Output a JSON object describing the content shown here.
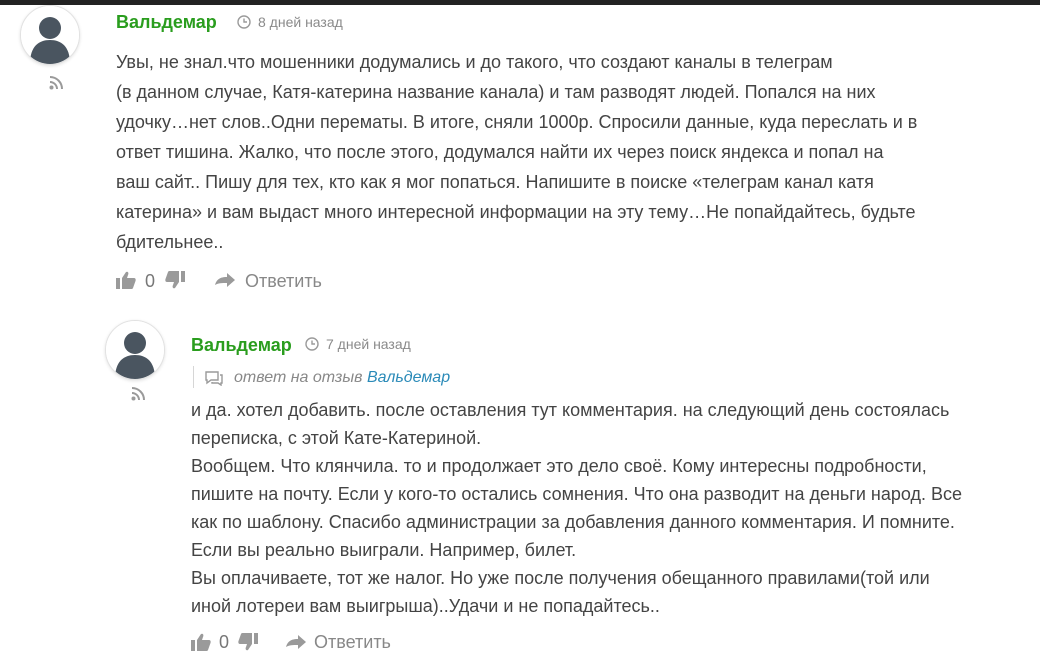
{
  "comments": [
    {
      "author": "Вальдемар",
      "date": "8 дней назад",
      "lines": [
        "Увы, не знал.что мошенники додумались и до такого, что создают каналы в телеграм",
        "(в данном случае, Катя-катерина название канала) и там разводят людей. Попался на них",
        "удочку…нет слов..Одни перематы. В итоге, сняли 1000р. Спросили данные, куда переслать и в",
        "ответ тишина. Жалко, что после этого, додумался найти их через поиск яндекса и попал на",
        "ваш сайт.. Пишу для тех, кто как я мог попаться. Напишите в поиске «телеграм канал катя",
        "катерина» и вам выдаст много интересной информации на эту тему…Не попайдайтесь, будьте",
        "бдительнее.."
      ],
      "votes": "0",
      "reply_label": "Ответить",
      "icons": {
        "avatar": "user-avatar-icon",
        "rss": "rss-icon",
        "clock": "clock-icon",
        "like": "thumbs-up-icon",
        "dislike": "thumbs-down-icon",
        "reply": "reply-arrow-icon"
      }
    },
    {
      "author": "Вальдемар",
      "date": "7 дней назад",
      "reply_to_text": "ответ на отзыв",
      "reply_to_name": "Вальдемар",
      "lines": [
        "и да. хотел добавить. после оставления тут комментария. на следующий день состоялась",
        "переписка, с этой Кате-Катериной.",
        "Вообщем. Что клянчила. то и продолжает это дело своё. Кому интересны подробности,",
        "пишите на почту. Если у кого-то остались сомнения. Что она разводит на деньги народ. Все",
        "как по шаблону. Спасибо администрации за добавления данного комментария. И помните.",
        "Если вы реально выиграли. Например, билет.",
        "Вы оплачиваете, тот же налог. Но уже после получения обещанного правилами(той или",
        "иной лотереи вам выигрыша)..Удачи и не попадайтесь.."
      ],
      "votes": "0",
      "reply_label": "Ответить",
      "icons": {
        "avatar": "user-avatar-icon",
        "rss": "rss-icon",
        "clock": "clock-icon",
        "comment": "comment-icon",
        "like": "thumbs-up-icon",
        "dislike": "thumbs-down-icon",
        "reply": "reply-arrow-icon"
      }
    }
  ],
  "colors": {
    "author": "#2a9d1e",
    "reply_link": "#2a8ab8",
    "muted": "#888888",
    "text": "#444444",
    "icon": "#9a9a9a"
  }
}
